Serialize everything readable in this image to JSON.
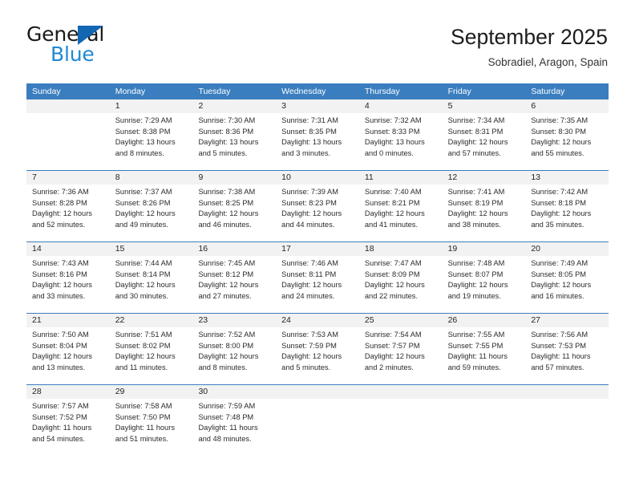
{
  "brand": {
    "name_part1": "General",
    "name_part2": "Blue",
    "logo_icon": "triangle-logo-icon"
  },
  "header": {
    "title": "September 2025",
    "subtitle": "Sobradiel, Aragon, Spain"
  },
  "colors": {
    "header_blue": "#3a7ebf",
    "brand_blue": "#2089d4",
    "logo_blue": "#1267b2",
    "daynum_band": "#f2f2f2",
    "text": "#2b2b2b"
  },
  "weekdays": [
    "Sunday",
    "Monday",
    "Tuesday",
    "Wednesday",
    "Thursday",
    "Friday",
    "Saturday"
  ],
  "weeks": [
    {
      "days": [
        {
          "num": "",
          "lines": []
        },
        {
          "num": "1",
          "lines": [
            "Sunrise: 7:29 AM",
            "Sunset: 8:38 PM",
            "Daylight: 13 hours",
            "and 8 minutes."
          ]
        },
        {
          "num": "2",
          "lines": [
            "Sunrise: 7:30 AM",
            "Sunset: 8:36 PM",
            "Daylight: 13 hours",
            "and 5 minutes."
          ]
        },
        {
          "num": "3",
          "lines": [
            "Sunrise: 7:31 AM",
            "Sunset: 8:35 PM",
            "Daylight: 13 hours",
            "and 3 minutes."
          ]
        },
        {
          "num": "4",
          "lines": [
            "Sunrise: 7:32 AM",
            "Sunset: 8:33 PM",
            "Daylight: 13 hours",
            "and 0 minutes."
          ]
        },
        {
          "num": "5",
          "lines": [
            "Sunrise: 7:34 AM",
            "Sunset: 8:31 PM",
            "Daylight: 12 hours",
            "and 57 minutes."
          ]
        },
        {
          "num": "6",
          "lines": [
            "Sunrise: 7:35 AM",
            "Sunset: 8:30 PM",
            "Daylight: 12 hours",
            "and 55 minutes."
          ]
        }
      ]
    },
    {
      "days": [
        {
          "num": "7",
          "lines": [
            "Sunrise: 7:36 AM",
            "Sunset: 8:28 PM",
            "Daylight: 12 hours",
            "and 52 minutes."
          ]
        },
        {
          "num": "8",
          "lines": [
            "Sunrise: 7:37 AM",
            "Sunset: 8:26 PM",
            "Daylight: 12 hours",
            "and 49 minutes."
          ]
        },
        {
          "num": "9",
          "lines": [
            "Sunrise: 7:38 AM",
            "Sunset: 8:25 PM",
            "Daylight: 12 hours",
            "and 46 minutes."
          ]
        },
        {
          "num": "10",
          "lines": [
            "Sunrise: 7:39 AM",
            "Sunset: 8:23 PM",
            "Daylight: 12 hours",
            "and 44 minutes."
          ]
        },
        {
          "num": "11",
          "lines": [
            "Sunrise: 7:40 AM",
            "Sunset: 8:21 PM",
            "Daylight: 12 hours",
            "and 41 minutes."
          ]
        },
        {
          "num": "12",
          "lines": [
            "Sunrise: 7:41 AM",
            "Sunset: 8:19 PM",
            "Daylight: 12 hours",
            "and 38 minutes."
          ]
        },
        {
          "num": "13",
          "lines": [
            "Sunrise: 7:42 AM",
            "Sunset: 8:18 PM",
            "Daylight: 12 hours",
            "and 35 minutes."
          ]
        }
      ]
    },
    {
      "days": [
        {
          "num": "14",
          "lines": [
            "Sunrise: 7:43 AM",
            "Sunset: 8:16 PM",
            "Daylight: 12 hours",
            "and 33 minutes."
          ]
        },
        {
          "num": "15",
          "lines": [
            "Sunrise: 7:44 AM",
            "Sunset: 8:14 PM",
            "Daylight: 12 hours",
            "and 30 minutes."
          ]
        },
        {
          "num": "16",
          "lines": [
            "Sunrise: 7:45 AM",
            "Sunset: 8:12 PM",
            "Daylight: 12 hours",
            "and 27 minutes."
          ]
        },
        {
          "num": "17",
          "lines": [
            "Sunrise: 7:46 AM",
            "Sunset: 8:11 PM",
            "Daylight: 12 hours",
            "and 24 minutes."
          ]
        },
        {
          "num": "18",
          "lines": [
            "Sunrise: 7:47 AM",
            "Sunset: 8:09 PM",
            "Daylight: 12 hours",
            "and 22 minutes."
          ]
        },
        {
          "num": "19",
          "lines": [
            "Sunrise: 7:48 AM",
            "Sunset: 8:07 PM",
            "Daylight: 12 hours",
            "and 19 minutes."
          ]
        },
        {
          "num": "20",
          "lines": [
            "Sunrise: 7:49 AM",
            "Sunset: 8:05 PM",
            "Daylight: 12 hours",
            "and 16 minutes."
          ]
        }
      ]
    },
    {
      "days": [
        {
          "num": "21",
          "lines": [
            "Sunrise: 7:50 AM",
            "Sunset: 8:04 PM",
            "Daylight: 12 hours",
            "and 13 minutes."
          ]
        },
        {
          "num": "22",
          "lines": [
            "Sunrise: 7:51 AM",
            "Sunset: 8:02 PM",
            "Daylight: 12 hours",
            "and 11 minutes."
          ]
        },
        {
          "num": "23",
          "lines": [
            "Sunrise: 7:52 AM",
            "Sunset: 8:00 PM",
            "Daylight: 12 hours",
            "and 8 minutes."
          ]
        },
        {
          "num": "24",
          "lines": [
            "Sunrise: 7:53 AM",
            "Sunset: 7:59 PM",
            "Daylight: 12 hours",
            "and 5 minutes."
          ]
        },
        {
          "num": "25",
          "lines": [
            "Sunrise: 7:54 AM",
            "Sunset: 7:57 PM",
            "Daylight: 12 hours",
            "and 2 minutes."
          ]
        },
        {
          "num": "26",
          "lines": [
            "Sunrise: 7:55 AM",
            "Sunset: 7:55 PM",
            "Daylight: 11 hours",
            "and 59 minutes."
          ]
        },
        {
          "num": "27",
          "lines": [
            "Sunrise: 7:56 AM",
            "Sunset: 7:53 PM",
            "Daylight: 11 hours",
            "and 57 minutes."
          ]
        }
      ]
    },
    {
      "days": [
        {
          "num": "28",
          "lines": [
            "Sunrise: 7:57 AM",
            "Sunset: 7:52 PM",
            "Daylight: 11 hours",
            "and 54 minutes."
          ]
        },
        {
          "num": "29",
          "lines": [
            "Sunrise: 7:58 AM",
            "Sunset: 7:50 PM",
            "Daylight: 11 hours",
            "and 51 minutes."
          ]
        },
        {
          "num": "30",
          "lines": [
            "Sunrise: 7:59 AM",
            "Sunset: 7:48 PM",
            "Daylight: 11 hours",
            "and 48 minutes."
          ]
        },
        {
          "num": "",
          "lines": []
        },
        {
          "num": "",
          "lines": []
        },
        {
          "num": "",
          "lines": []
        },
        {
          "num": "",
          "lines": []
        }
      ]
    }
  ]
}
